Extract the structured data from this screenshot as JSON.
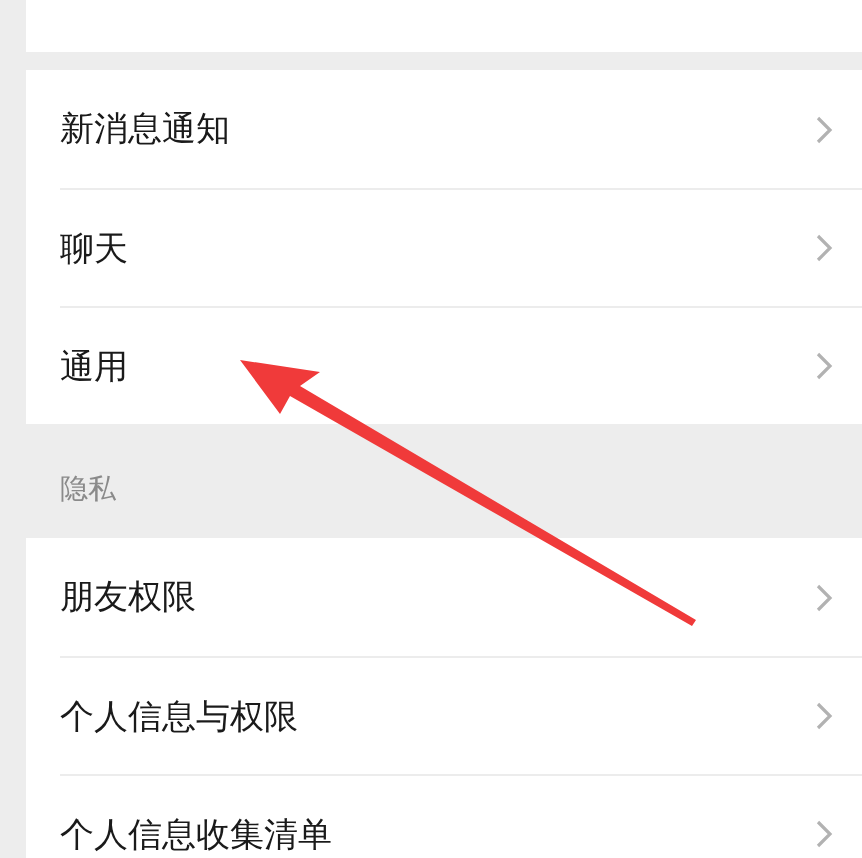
{
  "sections": [
    {
      "items": [
        {
          "label": "新消息通知"
        },
        {
          "label": "聊天"
        },
        {
          "label": "通用"
        }
      ]
    },
    {
      "header": "隐私",
      "items": [
        {
          "label": "朋友权限"
        },
        {
          "label": "个人信息与权限"
        },
        {
          "label": "个人信息收集清单"
        }
      ]
    }
  ]
}
